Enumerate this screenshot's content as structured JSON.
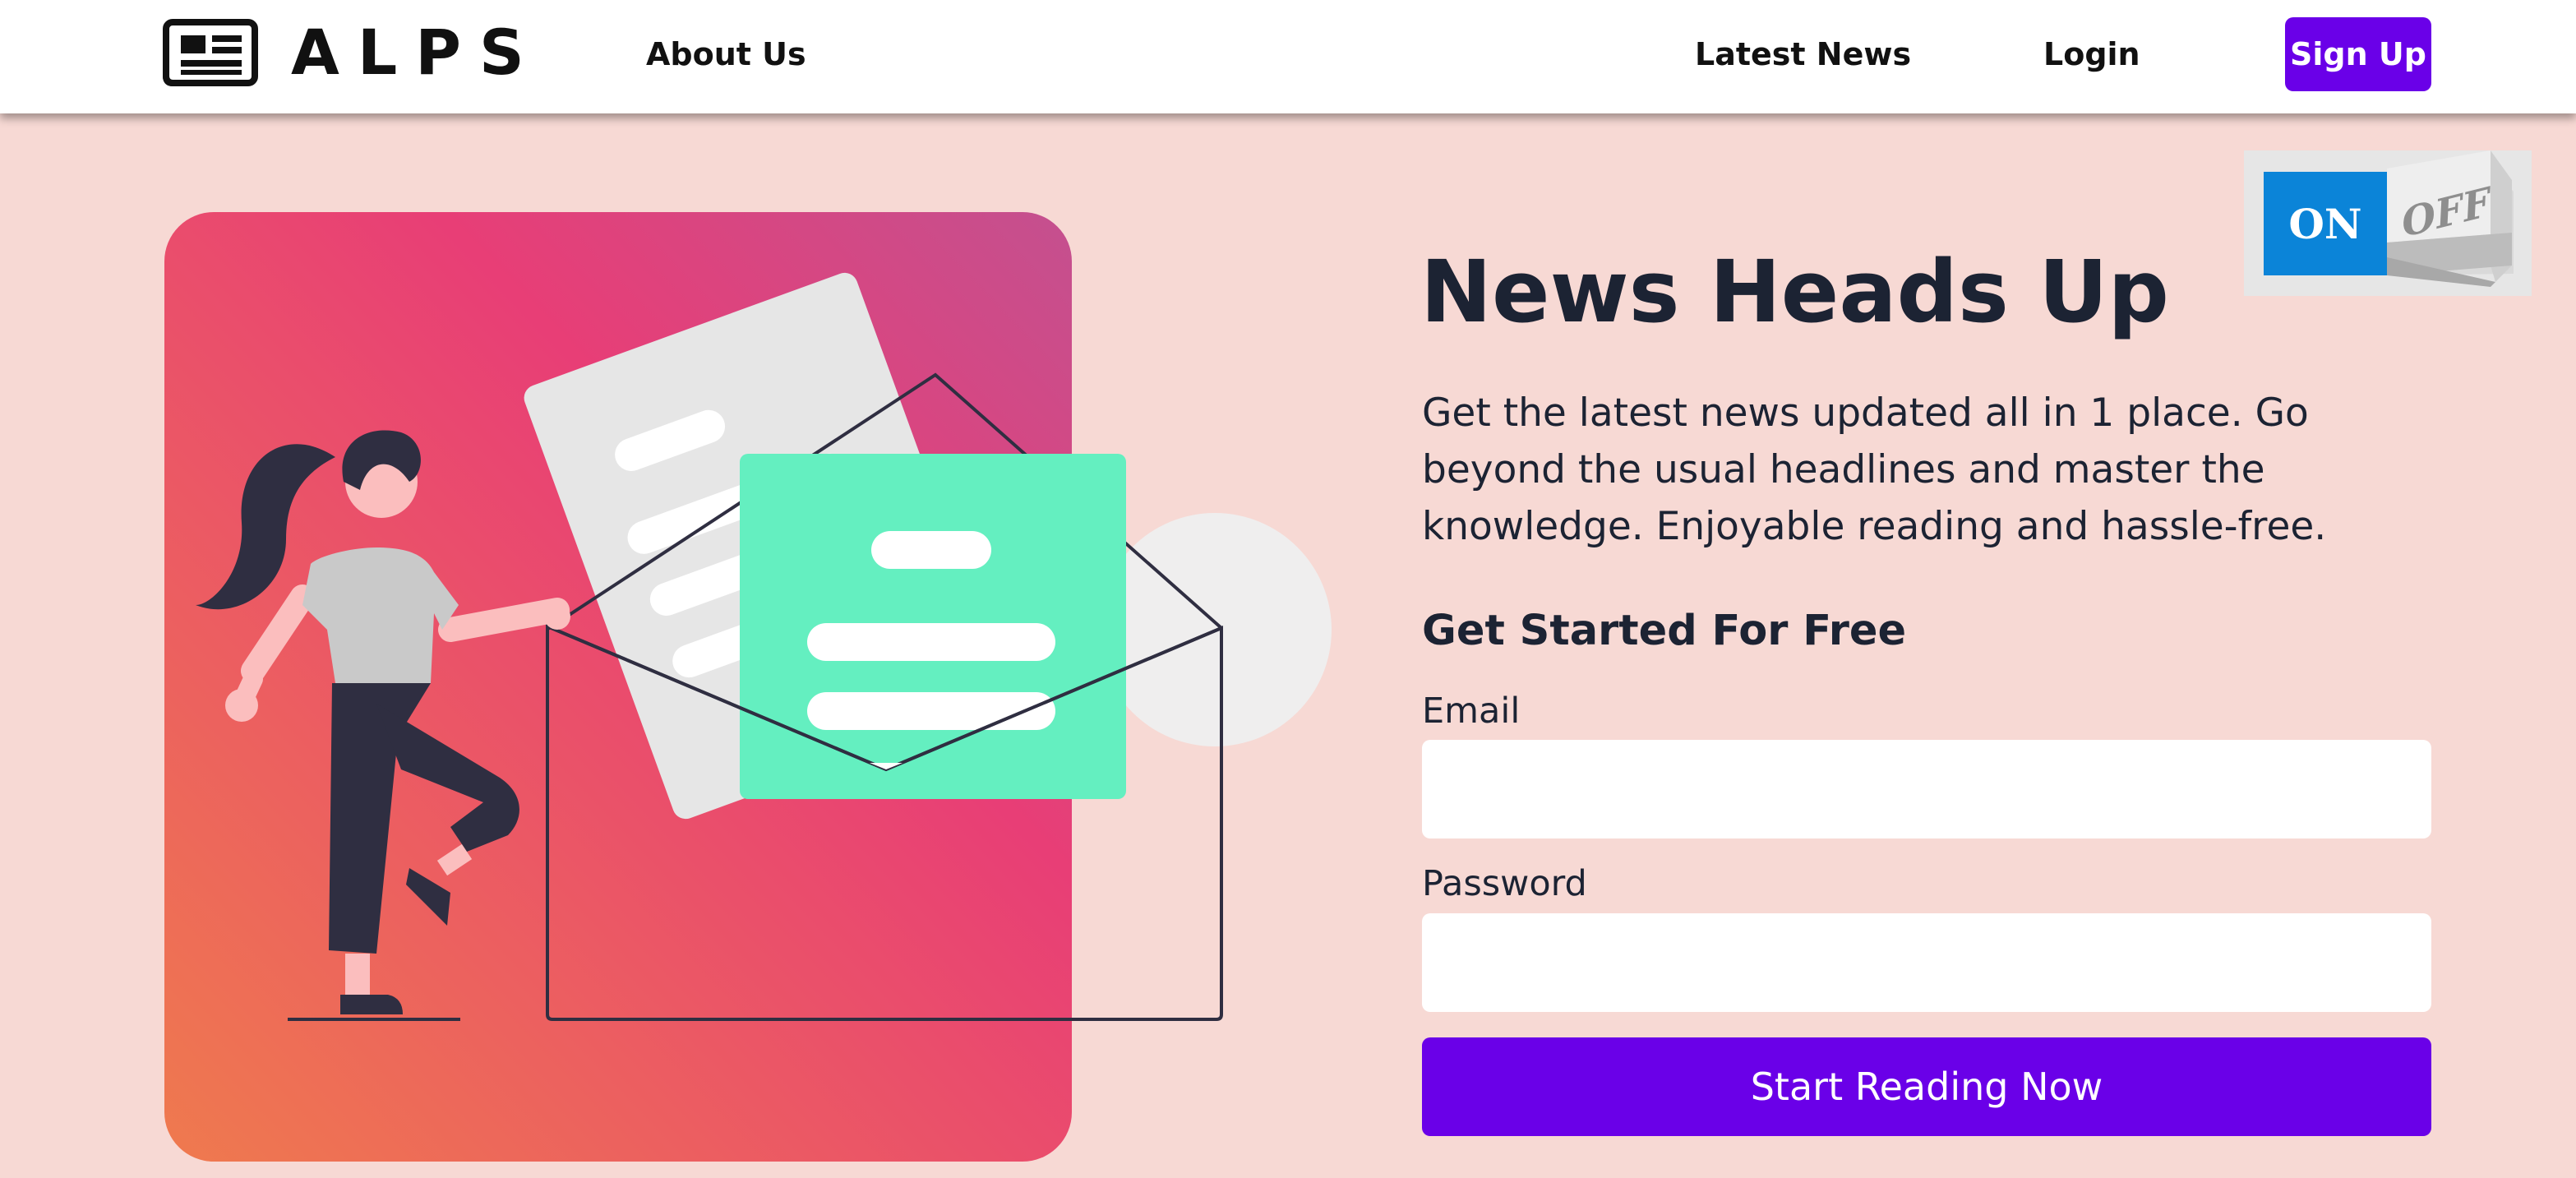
{
  "nav": {
    "brand_text": "ALPS",
    "brand_icon": "newspaper-icon",
    "about_label": "About Us",
    "latest_news_label": "Latest News",
    "login_label": "Login",
    "signup_label": "Sign Up"
  },
  "toggle": {
    "on_label": "ON",
    "off_label": "OFF"
  },
  "hero": {
    "illustration": "woman-with-envelope-illustration",
    "headline": "News Heads Up",
    "lead": "Get the latest news updated all in 1 place. Go beyond the usual headlines and master the knowledge. Enjoyable reading and hassle-free.",
    "subhead": "Get Started For Free"
  },
  "form": {
    "email_label": "Email",
    "email_value": "",
    "password_label": "Password",
    "password_value": "",
    "submit_label": "Start Reading Now"
  },
  "colors": {
    "page_background": "#f7d9d4",
    "primary": "#6a00e8",
    "text": "#1c2333",
    "toggle_on": "#0b84d8",
    "card_gradient_start": "#ef7a4e",
    "card_gradient_mid": "#e83e76",
    "card_gradient_end": "#c4508f",
    "mint": "#64efc0"
  }
}
